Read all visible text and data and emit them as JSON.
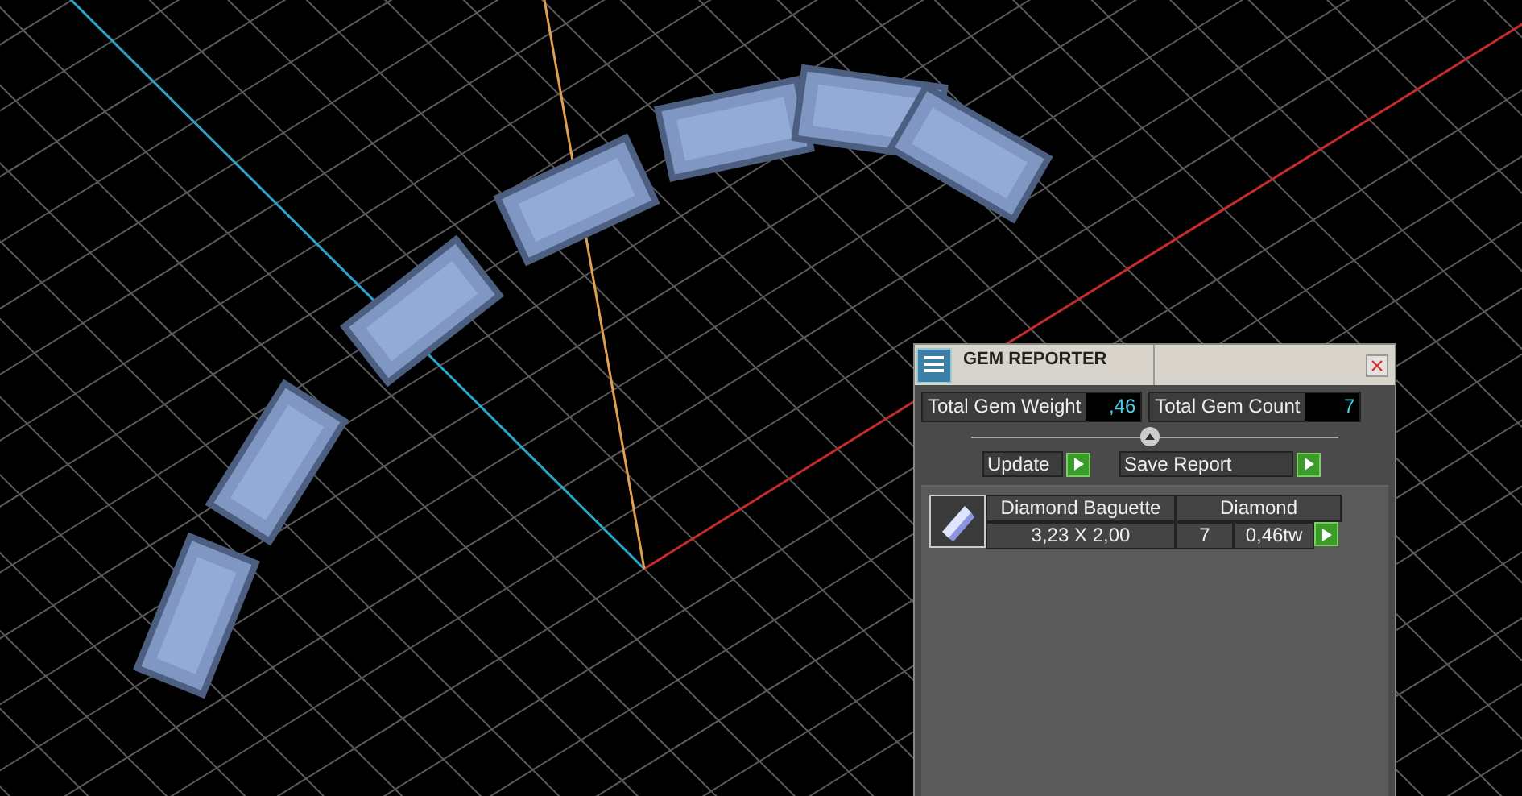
{
  "panel": {
    "title": "GEM REPORTER",
    "totals": [
      {
        "label": "Total Gem Weight",
        "value": ",46"
      },
      {
        "label": "Total Gem Count",
        "value": "7"
      }
    ],
    "buttons": [
      "Update",
      "Save Report"
    ],
    "gems": [
      {
        "name": "Diamond Baguette",
        "material": "Diamond",
        "size": "3,23 X 2,00",
        "count": "7",
        "weight": "0,46tw"
      }
    ]
  }
}
